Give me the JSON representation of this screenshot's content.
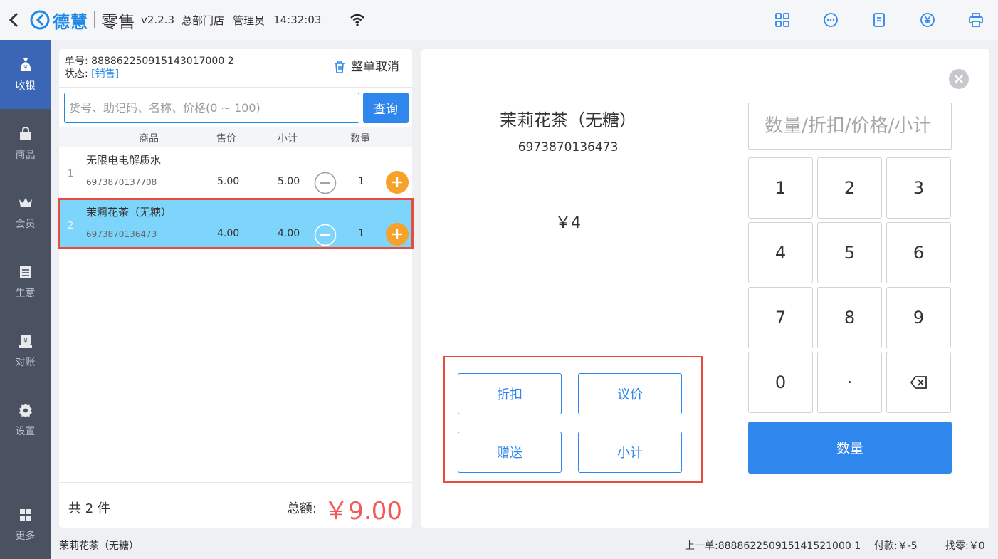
{
  "header": {
    "brand": "德慧",
    "app_name": "零售",
    "version": "v2.2.3",
    "store": "总部门店",
    "role": "管理员",
    "time": "14:32:03",
    "icons": [
      "grid-icon",
      "chat-icon",
      "document-icon",
      "yen-circle-icon",
      "printer-icon"
    ]
  },
  "nav": {
    "items": [
      {
        "label": "收银",
        "icon": "cash-bag-icon",
        "active": true
      },
      {
        "label": "商品",
        "icon": "shopping-bag-icon",
        "active": false
      },
      {
        "label": "会员",
        "icon": "crown-icon",
        "active": false
      },
      {
        "label": "生意",
        "icon": "ledger-icon",
        "active": false
      },
      {
        "label": "对账",
        "icon": "reconcile-icon",
        "active": false
      },
      {
        "label": "设置",
        "icon": "gear-icon",
        "active": false
      },
      {
        "label": "更多",
        "icon": "more-grid-icon",
        "active": false
      }
    ]
  },
  "order": {
    "number_label": "单号: ",
    "number": "888862250915143017000 2",
    "status_label": "状态: ",
    "status": "[销售]",
    "cancel_label": "整单取消",
    "search_placeholder": "货号、助记码、名称、价格(0 ~ 100)",
    "search_button": "查询",
    "columns": {
      "product": "商品",
      "price": "售价",
      "subtotal": "小计",
      "qty": "数量"
    },
    "rows": [
      {
        "index": "1",
        "name": "无限电电解质水",
        "code": "6973870137708",
        "price": "5.00",
        "subtotal": "5.00",
        "qty": "1"
      },
      {
        "index": "2",
        "name": "茉莉花茶（无糖）",
        "code": "6973870136473",
        "price": "4.00",
        "subtotal": "4.00",
        "qty": "1"
      }
    ],
    "count_text": "共 2 件",
    "total_label": "总额:",
    "total": "￥9.00"
  },
  "detail": {
    "product_name": "茉莉花茶（无糖）",
    "product_code": "6973870136473",
    "price": "￥4",
    "actions": {
      "discount": "折扣",
      "negotiate": "议价",
      "gift": "赠送",
      "subtotal": "小计"
    },
    "input_placeholder": "数量/折扣/价格/小计",
    "keys": [
      "1",
      "2",
      "3",
      "4",
      "5",
      "6",
      "7",
      "8",
      "9",
      "0",
      "·"
    ],
    "confirm_label": "数量"
  },
  "statusbar": {
    "current_item": "茉莉花茶（无糖）",
    "previous_order": "上一单:888862250915141521000 1",
    "paid": "付款:￥-5",
    "change": "找零:￥0"
  },
  "colors": {
    "accent": "#2f86ec",
    "nav_bg": "#4a5160",
    "nav_active": "#3a66b5",
    "highlight": "#7dd5fb",
    "plus": "#f5a12a",
    "total": "#f25a5a",
    "annotation": "#e74c3c"
  }
}
